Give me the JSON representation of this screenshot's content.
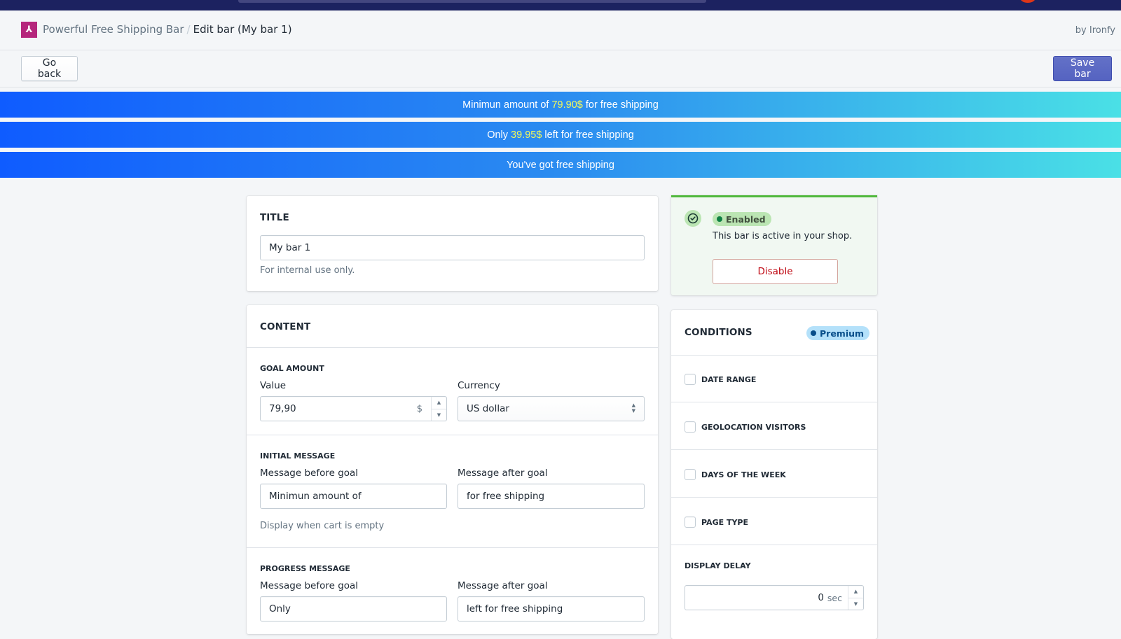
{
  "header": {
    "app_name": "Powerful Free Shipping Bar",
    "separator": "/",
    "current_page": "Edit bar (My bar 1)",
    "byline": "by Ironfy",
    "logo_glyph": "⅄"
  },
  "actions": {
    "go_back_label": "Go back",
    "save_label": "Save bar"
  },
  "preview": {
    "colors": {
      "gradient_start": "#0f5cff",
      "gradient_end": "#4ae0e6",
      "text": "#ffffff",
      "amount": "#f4f95a"
    },
    "initial": {
      "before": "Minimun amount of ",
      "amount": "79.90$",
      "after": " for free shipping"
    },
    "progress": {
      "before": "Only ",
      "amount": "39.95$",
      "after": " left for free shipping"
    },
    "goal": {
      "text": "You've got free shipping"
    }
  },
  "title_card": {
    "heading": "TITLE",
    "input_value": "My bar 1",
    "help": "For internal use only."
  },
  "content_card": {
    "heading": "CONTENT",
    "goal_amount": {
      "heading": "GOAL AMOUNT",
      "value_label": "Value",
      "value": "79,90",
      "suffix": "$",
      "currency_label": "Currency",
      "currency_selected": "US dollar"
    },
    "initial_message": {
      "heading": "INITIAL MESSAGE",
      "before_label": "Message before goal",
      "before_value": "Minimun amount of",
      "after_label": "Message after goal",
      "after_value": "for free shipping",
      "help": "Display when cart is empty"
    },
    "progress_message": {
      "heading": "PROGRESS MESSAGE",
      "before_label": "Message before goal",
      "before_value": "Only",
      "after_label": "Message after goal",
      "after_value": "left for free shipping"
    }
  },
  "status_card": {
    "badge": "Enabled",
    "description": "This bar is active in your shop.",
    "disable_label": "Disable",
    "colors": {
      "accent": "#50b83c",
      "badge_bg": "#bbe5b3",
      "badge_text": "#414f3e"
    }
  },
  "conditions_card": {
    "heading": "CONDITIONS",
    "badge": "Premium",
    "items": [
      {
        "label": "DATE RANGE",
        "checked": false
      },
      {
        "label": "GEOLOCATION VISITORS",
        "checked": false
      },
      {
        "label": "DAYS OF THE WEEK",
        "checked": false
      },
      {
        "label": "PAGE TYPE",
        "checked": false
      }
    ],
    "display_delay": {
      "heading": "DISPLAY DELAY",
      "value": "0",
      "unit": "sec"
    }
  }
}
